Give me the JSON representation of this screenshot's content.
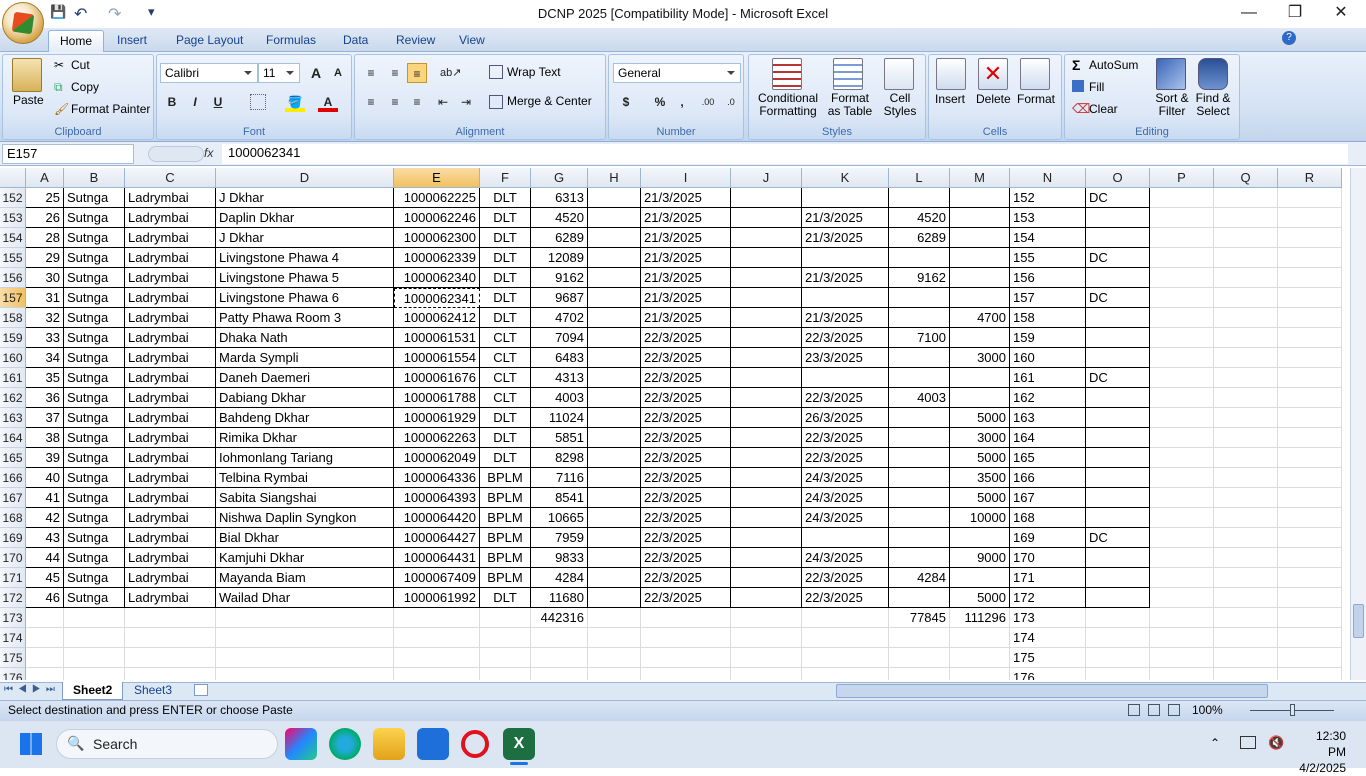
{
  "window": {
    "title": "DCNP 2025  [Compatibility Mode] - Microsoft Excel",
    "controls": {
      "minimize": "—",
      "restore": "❐",
      "close": "✕"
    },
    "qat": {
      "save": "💾",
      "undo": "↶",
      "redo": "↷",
      "customize": "▾"
    }
  },
  "ribbon_tabs": [
    "Home",
    "Insert",
    "Page Layout",
    "Formulas",
    "Data",
    "Review",
    "View"
  ],
  "ribbon": {
    "clipboard": {
      "label": "Clipboard",
      "paste": "Paste",
      "cut": "Cut",
      "copy": "Copy",
      "format_painter": "Format Painter"
    },
    "font": {
      "label": "Font",
      "name": "Calibri",
      "size": "11",
      "bold": "B",
      "italic": "I",
      "underline": "U",
      "grow": "A",
      "shrink": "A"
    },
    "alignment": {
      "label": "Alignment",
      "wrap": "Wrap Text",
      "merge": "Merge & Center"
    },
    "number": {
      "label": "Number",
      "format": "General",
      "currency": "$",
      "percent": "%",
      "comma": ","
    },
    "styles": {
      "label": "Styles",
      "conditional": "Conditional\nFormatting",
      "cond1": "Conditional",
      "cond2": "Formatting",
      "fmt1": "Format",
      "fmt2": "as Table",
      "cell1": "Cell",
      "cell2": "Styles"
    },
    "cells": {
      "label": "Cells",
      "insert": "Insert",
      "delete": "Delete",
      "format": "Format"
    },
    "editing": {
      "label": "Editing",
      "autosum": "AutoSum",
      "fill": "Fill",
      "clear": "Clear",
      "sort1": "Sort &",
      "sort2": "Filter",
      "find1": "Find &",
      "find2": "Select"
    }
  },
  "formula_bar": {
    "name_box": "E157",
    "fx": "fx",
    "value": "1000062341"
  },
  "columns": [
    "A",
    "B",
    "C",
    "D",
    "E",
    "F",
    "G",
    "H",
    "I",
    "J",
    "K",
    "L",
    "M",
    "N",
    "O",
    "P",
    "Q",
    "R"
  ],
  "rows": [
    {
      "n": "152",
      "a": "25",
      "b": "Sutnga",
      "c": "Ladrymbai",
      "d": "J Dkhar",
      "e": "1000062225",
      "f": "DLT",
      "g": "6313",
      "i": "21/3/2025",
      "k": "",
      "l": "",
      "m": "",
      "o": "DC"
    },
    {
      "n": "153",
      "a": "26",
      "b": "Sutnga",
      "c": "Ladrymbai",
      "d": "Daplin Dkhar",
      "e": "1000062246",
      "f": "DLT",
      "g": "4520",
      "i": "21/3/2025",
      "k": "21/3/2025",
      "l": "4520",
      "m": "",
      "o": ""
    },
    {
      "n": "154",
      "a": "28",
      "b": "Sutnga",
      "c": "Ladrymbai",
      "d": "J Dkhar",
      "e": "1000062300",
      "f": "DLT",
      "g": "6289",
      "i": "21/3/2025",
      "k": "21/3/2025",
      "l": "6289",
      "m": "",
      "o": ""
    },
    {
      "n": "155",
      "a": "29",
      "b": "Sutnga",
      "c": "Ladrymbai",
      "d": "Livingstone Phawa 4",
      "e": "1000062339",
      "f": "DLT",
      "g": "12089",
      "i": "21/3/2025",
      "k": "",
      "l": "",
      "m": "",
      "o": "DC"
    },
    {
      "n": "156",
      "a": "30",
      "b": "Sutnga",
      "c": "Ladrymbai",
      "d": "Livingstone Phawa 5",
      "e": "1000062340",
      "f": "DLT",
      "g": "9162",
      "i": "21/3/2025",
      "k": "21/3/2025",
      "l": "9162",
      "m": "",
      "o": ""
    },
    {
      "n": "157",
      "a": "31",
      "b": "Sutnga",
      "c": "Ladrymbai",
      "d": "Livingstone Phawa 6",
      "e": "1000062341",
      "f": "DLT",
      "g": "9687",
      "i": "21/3/2025",
      "k": "",
      "l": "",
      "m": "",
      "o": "DC"
    },
    {
      "n": "158",
      "a": "32",
      "b": "Sutnga",
      "c": "Ladrymbai",
      "d": "Patty Phawa Room 3",
      "e": "1000062412",
      "f": "DLT",
      "g": "4702",
      "i": "21/3/2025",
      "k": "21/3/2025",
      "l": "",
      "m": "4700",
      "o": ""
    },
    {
      "n": "159",
      "a": "33",
      "b": "Sutnga",
      "c": "Ladrymbai",
      "d": "Dhaka Nath",
      "e": "1000061531",
      "f": "CLT",
      "g": "7094",
      "i": "22/3/2025",
      "k": "22/3/2025",
      "l": "7100",
      "m": "",
      "o": ""
    },
    {
      "n": "160",
      "a": "34",
      "b": "Sutnga",
      "c": "Ladrymbai",
      "d": "Marda Sympli",
      "e": "1000061554",
      "f": "CLT",
      "g": "6483",
      "i": "22/3/2025",
      "k": "23/3/2025",
      "l": "",
      "m": "3000",
      "o": ""
    },
    {
      "n": "161",
      "a": "35",
      "b": "Sutnga",
      "c": "Ladrymbai",
      "d": "Daneh Daemeri",
      "e": "1000061676",
      "f": "CLT",
      "g": "4313",
      "i": "22/3/2025",
      "k": "",
      "l": "",
      "m": "",
      "o": "DC"
    },
    {
      "n": "162",
      "a": "36",
      "b": "Sutnga",
      "c": "Ladrymbai",
      "d": "Dabiang Dkhar",
      "e": "1000061788",
      "f": "CLT",
      "g": "4003",
      "i": "22/3/2025",
      "k": "22/3/2025",
      "l": "4003",
      "m": "",
      "o": ""
    },
    {
      "n": "163",
      "a": "37",
      "b": "Sutnga",
      "c": "Ladrymbai",
      "d": "Bahdeng Dkhar",
      "e": "1000061929",
      "f": "DLT",
      "g": "11024",
      "i": "22/3/2025",
      "k": "26/3/2025",
      "l": "",
      "m": "5000",
      "o": ""
    },
    {
      "n": "164",
      "a": "38",
      "b": "Sutnga",
      "c": "Ladrymbai",
      "d": "Rimika Dkhar",
      "e": "1000062263",
      "f": "DLT",
      "g": "5851",
      "i": "22/3/2025",
      "k": "22/3/2025",
      "l": "",
      "m": "3000",
      "o": ""
    },
    {
      "n": "165",
      "a": "39",
      "b": "Sutnga",
      "c": "Ladrymbai",
      "d": "Iohmonlang Tariang",
      "e": "1000062049",
      "f": "DLT",
      "g": "8298",
      "i": "22/3/2025",
      "k": "22/3/2025",
      "l": "",
      "m": "5000",
      "o": ""
    },
    {
      "n": "166",
      "a": "40",
      "b": "Sutnga",
      "c": "Ladrymbai",
      "d": "Telbina Rymbai",
      "e": "1000064336",
      "f": "BPLM",
      "g": "7116",
      "i": "22/3/2025",
      "k": "24/3/2025",
      "l": "",
      "m": "3500",
      "o": ""
    },
    {
      "n": "167",
      "a": "41",
      "b": "Sutnga",
      "c": "Ladrymbai",
      "d": "Sabita Siangshai",
      "e": "1000064393",
      "f": "BPLM",
      "g": "8541",
      "i": "22/3/2025",
      "k": "24/3/2025",
      "l": "",
      "m": "5000",
      "o": ""
    },
    {
      "n": "168",
      "a": "42",
      "b": "Sutnga",
      "c": "Ladrymbai",
      "d": "Nishwa Daplin Syngkon",
      "e": "1000064420",
      "f": "BPLM",
      "g": "10665",
      "i": "22/3/2025",
      "k": "24/3/2025",
      "l": "",
      "m": "10000",
      "o": ""
    },
    {
      "n": "169",
      "a": "43",
      "b": "Sutnga",
      "c": "Ladrymbai",
      "d": "Bial Dkhar",
      "e": "1000064427",
      "f": "BPLM",
      "g": "7959",
      "i": "22/3/2025",
      "k": "",
      "l": "",
      "m": "",
      "o": "DC"
    },
    {
      "n": "170",
      "a": "44",
      "b": "Sutnga",
      "c": "Ladrymbai",
      "d": "Kamjuhi  Dkhar",
      "e": "1000064431",
      "f": "BPLM",
      "g": "9833",
      "i": "22/3/2025",
      "k": "24/3/2025",
      "l": "",
      "m": "9000",
      "o": ""
    },
    {
      "n": "171",
      "a": "45",
      "b": "Sutnga",
      "c": "Ladrymbai",
      "d": "Mayanda Biam",
      "e": "1000067409",
      "f": "BPLM",
      "g": "4284",
      "i": "22/3/2025",
      "k": "22/3/2025",
      "l": "4284",
      "m": "",
      "o": ""
    },
    {
      "n": "172",
      "a": "46",
      "b": "Sutnga",
      "c": "Ladrymbai",
      "d": "Wailad Dhar",
      "e": "1000061992",
      "f": "DLT",
      "g": "11680",
      "i": "22/3/2025",
      "k": "22/3/2025",
      "l": "",
      "m": "5000",
      "o": ""
    }
  ],
  "totals_row": {
    "n": "173",
    "g": "442316",
    "l": "77845",
    "m": "111296"
  },
  "empty_rows": [
    "174",
    "175",
    "176"
  ],
  "sheet_tabs": [
    "Sheet2",
    "Sheet3"
  ],
  "status": {
    "message": "Select destination and press ENTER or choose Paste",
    "zoom": "100%"
  },
  "taskbar": {
    "search": "Search",
    "time": "12:30 PM",
    "date": "4/2/2025"
  },
  "colors": {
    "selection": "#f1c15f",
    "ribbon": "#d6e3f4",
    "header_text": "#15428b"
  }
}
